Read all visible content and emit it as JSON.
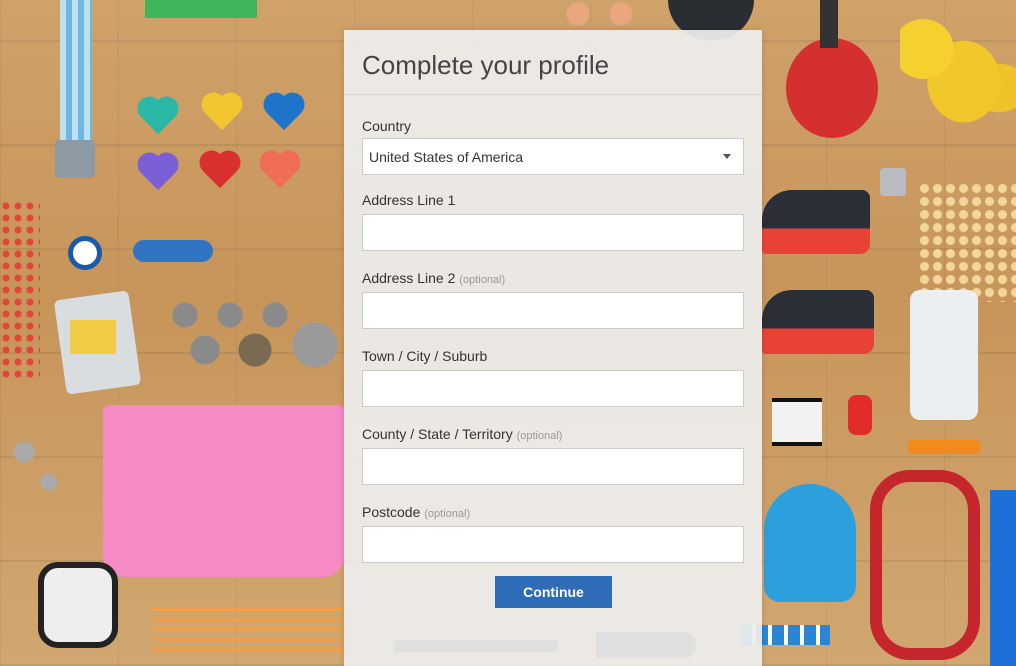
{
  "form": {
    "title": "Complete your profile",
    "optional_marker": "(optional)",
    "country": {
      "label": "Country",
      "selected": "United States of America"
    },
    "fields": [
      {
        "label": "Address Line 1",
        "optional": false,
        "value": ""
      },
      {
        "label": "Address Line 2",
        "optional": true,
        "value": ""
      },
      {
        "label": "Town / City / Suburb",
        "optional": false,
        "value": ""
      },
      {
        "label": "County / State / Territory",
        "optional": true,
        "value": ""
      },
      {
        "label": "Postcode",
        "optional": true,
        "value": ""
      }
    ],
    "continue_label": "Continue"
  },
  "colors": {
    "button": "#2e6cb8",
    "panel": "#eeeeee"
  }
}
